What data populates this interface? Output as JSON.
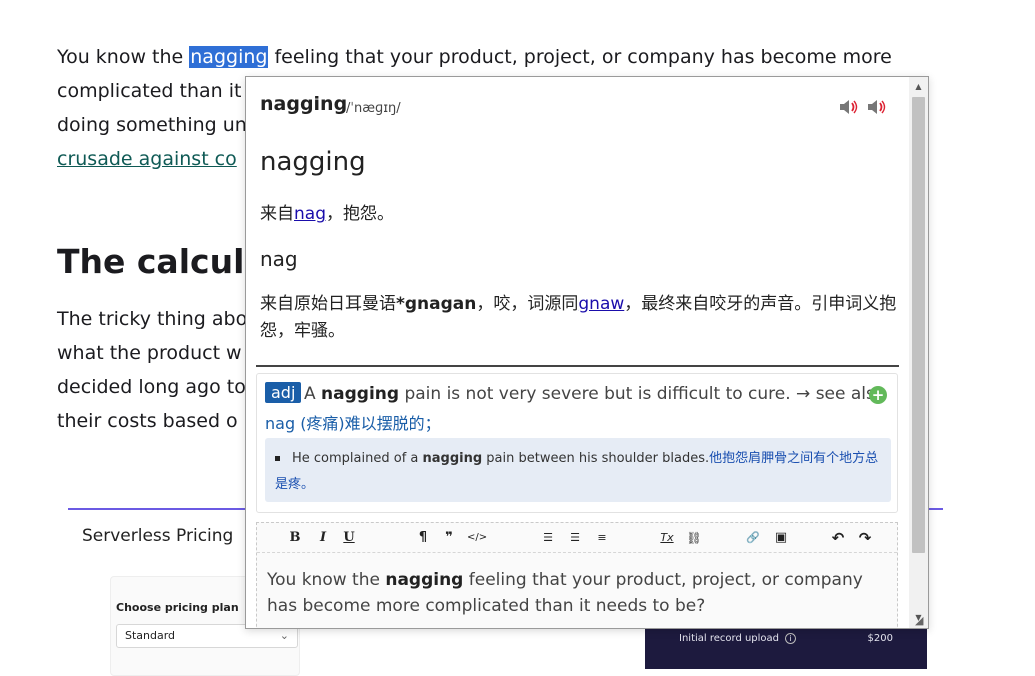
{
  "article": {
    "p1_line1_a": "You know the ",
    "p1_highlight": "nagging",
    "p1_line1_b": " feeling that your product, project, or company has become more",
    "p1_line2": "complicated than it",
    "p1_line3": "doing something un",
    "p1_link": "crusade against co",
    "heading": "The calculat",
    "p2_line1": "The tricky thing abo",
    "p2_line2": "what the product w",
    "p2_line3": "decided long ago to",
    "p2_line4": "their costs based o"
  },
  "pricing_card": {
    "title": "Serverless Pricing",
    "choose_label": "Choose pricing plan",
    "select_value": "Standard",
    "upload_label": "Initial record upload",
    "upload_price": "$200"
  },
  "popup": {
    "headword": "nagging",
    "phonetic": "/ˈnæɡɪŋ/",
    "entry_title": "nagging",
    "ety1_prefix": "来自",
    "ety1_link": "nag",
    "ety1_suffix": "，抱怨。",
    "sub_word": "nag",
    "ety2_a": "来自原始日耳曼语",
    "ety2_bold": "*gnagan",
    "ety2_b": "，咬，词源同",
    "ety2_link": "gnaw",
    "ety2_c": "，最终来自咬牙的声音。引申词义抱怨，牢骚。",
    "pos": "adj",
    "def_a": "A ",
    "def_bold": "nagging",
    "def_b": " pain is not very severe but is difficult to cure. → see also",
    "def_cn": "nag (疼痛)难以摆脱的；",
    "example_a": "He complained of a ",
    "example_bold": "nagging",
    "example_b": " pain between his shoulder blades.",
    "example_cn": "他抱怨肩胛骨之间有个地方总是疼。",
    "editor_a": "You know the ",
    "editor_bold": "nagging",
    "editor_b": " feeling that your product, project, or company has become more complicated than it needs to be?"
  },
  "toolbar": {
    "bold": "B",
    "italic": "I",
    "underline": "U",
    "paragraph": "¶",
    "quote": "❞",
    "code": "</>",
    "ol": "☰",
    "ul": "☰",
    "indent": "≡",
    "clear": "Tx",
    "unlink": "⛓",
    "link": "🔗",
    "image": "▣",
    "undo": "↶",
    "redo": "↷"
  },
  "icons": {
    "speaker_uk": "speaker-icon",
    "speaker_us": "speaker-icon",
    "add": "plus-icon"
  },
  "colors": {
    "highlight": "#2f6fd6",
    "link_teal": "#0f5a55",
    "pos_badge": "#1a5ea8",
    "example_bg": "#e6ecf5",
    "add_green": "#62b95a"
  }
}
